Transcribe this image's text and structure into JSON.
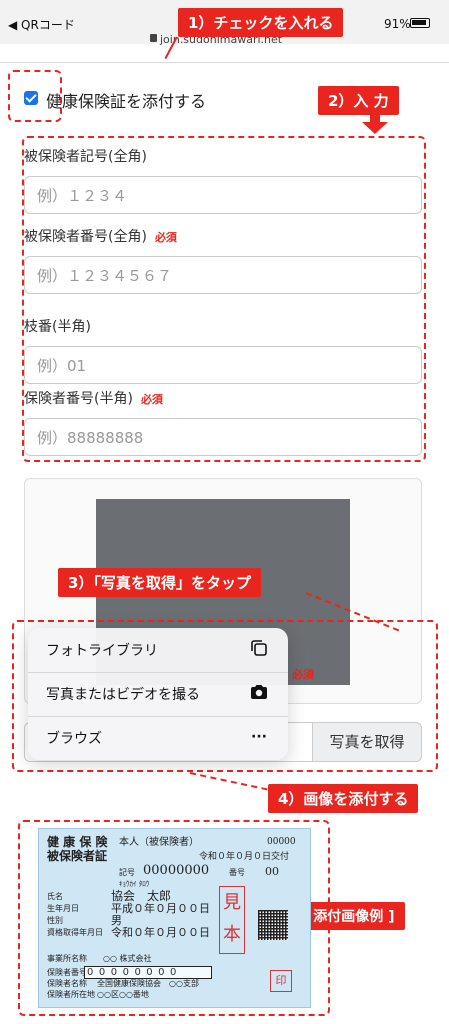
{
  "status": {
    "carrier": "◀ QRコード",
    "battery": "91%",
    "url": "join.sudohimawari.net"
  },
  "callouts": {
    "step1": "1）チェックを入れる",
    "step2": "2）入 力",
    "step3": "3）「写真を取得」をタップ",
    "step4": "4）画像を添付する",
    "example": "[ 添付画像例 ]"
  },
  "form": {
    "attach_checkbox_label": "健康保険証を添付する",
    "attach_checked": true,
    "required_label": "必須",
    "fields": [
      {
        "label": "被保険者記号(全角)",
        "placeholder": "例）１２３４",
        "required": false
      },
      {
        "label": "被保険者番号(全角)",
        "placeholder": "例）１２３４５６７",
        "required": true
      },
      {
        "label": "枝番(半角)",
        "placeholder": "例）01",
        "required": false
      },
      {
        "label": "保険者番号(半角)",
        "placeholder": "例）88888888",
        "required": false
      }
    ],
    "photo_required_label": "必須",
    "photo_button": "写真を取得"
  },
  "menu": {
    "items": [
      {
        "label": "フォトライブラリ",
        "icon": "photo-library-icon"
      },
      {
        "label": "写真またはビデオを撮る",
        "icon": "camera-icon"
      },
      {
        "label": "ブラウズ",
        "icon": "more-icon"
      }
    ]
  },
  "card": {
    "title1": "健 康 保 険",
    "title2": "被保険者証",
    "person": "本人（被保険者）",
    "code": "00000",
    "issued": "令和０年０月０日交付",
    "kigo_label": "記号",
    "kigo": "00000000",
    "bango_label": "番号",
    "bango": "00",
    "furigana": "ｷｮｳｶｲ  ﾀﾛｳ",
    "name_label": "氏名",
    "name": "協会　太郎",
    "birth_label": "生年月日",
    "birth": "平成０年０月００日",
    "sex_label": "性別",
    "sex": "男",
    "acq_label": "資格取得年月日",
    "acq": "令和０年０月００日",
    "office_label": "事業所名称",
    "office": "○○ 株式会社",
    "insurer_no_label": "保険者番号",
    "insurer_no": "00000000",
    "insurer_name_label": "保険者名称",
    "insurer_name": "全国健康保険協会　○○支部",
    "insurer_addr_label": "保険者所在地",
    "insurer_addr": "○○区○○番地",
    "stamp_mihon": "見本",
    "stamp_in": "印"
  }
}
